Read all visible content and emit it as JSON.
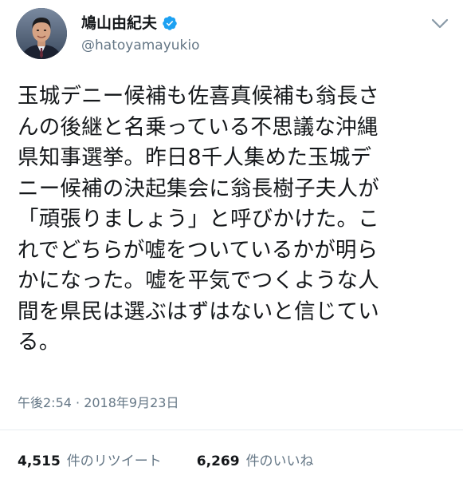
{
  "author": {
    "display_name": "鳩山由紀夫",
    "handle": "@hatoyamayukio",
    "verified": true,
    "avatar_icon": "profile-photo"
  },
  "menu_icon": "chevron-down-icon",
  "tweet": {
    "lines": [
      "玉城デニー候補も佐喜真候補も翁長さ",
      "んの後継と名乗っている不思議な沖縄",
      "県知事選挙。昨日8千人集めた玉城デ",
      "ニー候補の決起集会に翁長樹子夫人が",
      "「頑張りましょう」と呼びかけた。こ",
      "れでどちらが嘘をついているかが明ら",
      "かになった。嘘を平気でつくような人",
      "間を県民は選ぶはずはないと信じてい",
      "る。"
    ],
    "timestamp": "午後2:54 · 2018年9月23日"
  },
  "stats": {
    "retweets": {
      "count": "4,515",
      "label": "件のリツイート"
    },
    "likes": {
      "count": "6,269",
      "label": "件のいいね"
    }
  },
  "colors": {
    "verified_blue": "#1da1f2",
    "secondary_text": "#657786",
    "primary_text": "#14171a"
  }
}
